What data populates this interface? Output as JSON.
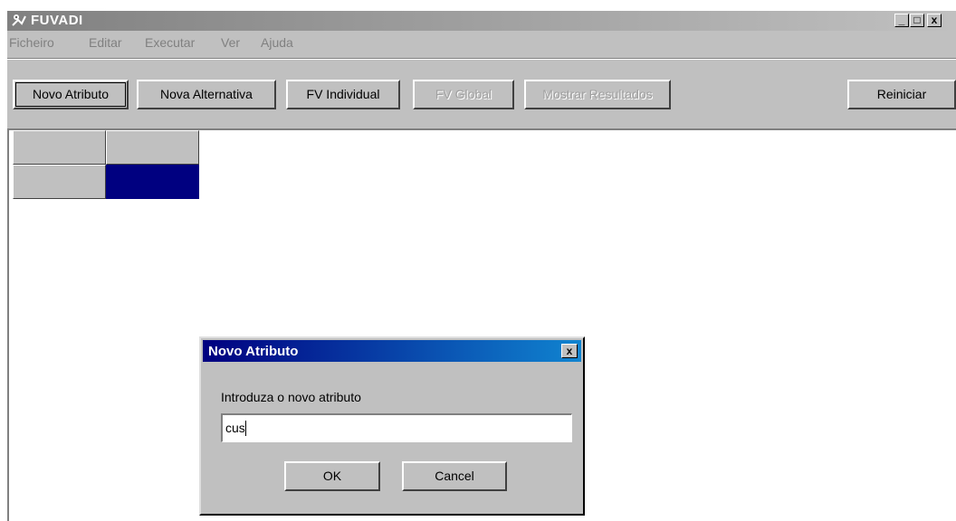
{
  "window": {
    "title": "FUVADI",
    "controls": {
      "minimize": "_",
      "maximize": "□",
      "close": "x"
    }
  },
  "menu": [
    {
      "label": "Ficheiro"
    },
    {
      "label": "Editar"
    },
    {
      "label": "Executar"
    },
    {
      "label": "Ver"
    },
    {
      "label": "Ajuda"
    }
  ],
  "toolbar": {
    "novo_atributo": "Novo Atributo",
    "nova_alternativa": "Nova Alternativa",
    "fv_individual": "FV Individual",
    "fv_global": "FV Global",
    "mostrar_resultados": "Mostrar Resultados",
    "reiniciar": "Reiniciar"
  },
  "dialog": {
    "title": "Novo Atributo",
    "close": "x",
    "prompt": "Introduza o novo atributo",
    "input_value": "cus",
    "ok": "OK",
    "cancel": "Cancel"
  },
  "colors": {
    "face": "#c0c0c0",
    "selection": "#000080",
    "titlebar_active": "#000080",
    "titlebar_inactive": "#808080"
  }
}
